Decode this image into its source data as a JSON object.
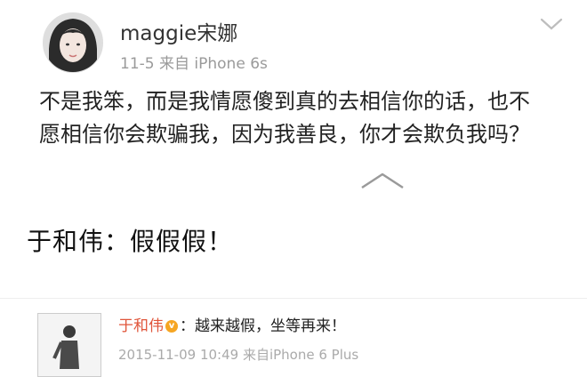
{
  "post": {
    "username": "maggie宋娜",
    "timestamp": "11-5",
    "source": "来自 iPhone 6s",
    "body": "不是我笨，而是我情愿傻到真的去相信你的话，也不愿相信你会欺骗我，因为我善良，你才会欺负我吗？"
  },
  "caption": "于和伟：假假假！",
  "comment": {
    "author": "于和伟",
    "badge": "v",
    "separator": "：",
    "text": "越来越假，坐等再来！",
    "timestamp": "2015-11-09 10:49",
    "source": "来自iPhone 6 Plus"
  },
  "icons": {
    "collapse": "chevron-down-icon",
    "expand": "caret-up-icon"
  },
  "colors": {
    "author_name": "#e0553a",
    "vip_badge": "#f6a623"
  }
}
